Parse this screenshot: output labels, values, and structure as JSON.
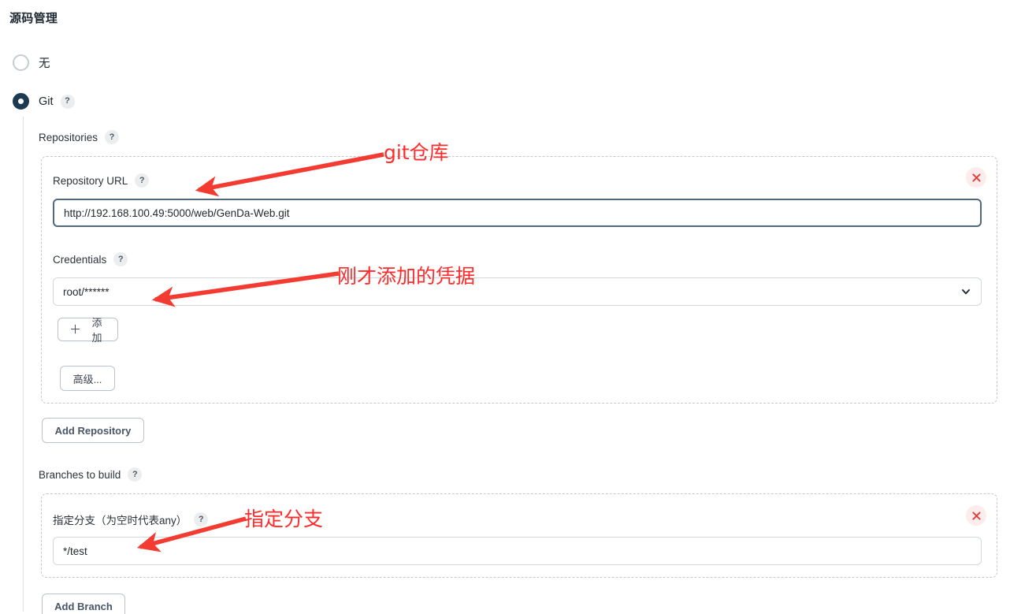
{
  "section": {
    "title": "源码管理"
  },
  "scm_options": [
    {
      "label": "无",
      "selected": false,
      "has_help": false
    },
    {
      "label": "Git",
      "selected": true,
      "has_help": true,
      "help_glyph": "?"
    }
  ],
  "git": {
    "repositories_label": "Repositories",
    "help_glyph": "?",
    "repository": {
      "url_label": "Repository URL",
      "url_value": "http://192.168.100.49:5000/web/GenDa-Web.git",
      "url_placeholder": "",
      "credentials_label": "Credentials",
      "credentials_value": "root/******",
      "add_credentials_label": "添加",
      "add_credentials_icon": "plus-icon",
      "advanced_label": "高级...",
      "delete_icon": "close-icon"
    },
    "add_repository_label": "Add Repository",
    "branches_label": "Branches to build",
    "branch": {
      "spec_label": "指定分支（为空时代表any）",
      "spec_value": "*/test",
      "delete_icon": "close-icon"
    },
    "add_branch_label": "Add Branch"
  },
  "annotations": [
    {
      "text": "git仓库",
      "target": "repository-url-field"
    },
    {
      "text": "刚才添加的凭据",
      "target": "credentials-select"
    },
    {
      "text": "指定分支",
      "target": "branch-spec-field"
    }
  ],
  "colors": {
    "annotation_red": "#ff2b2b",
    "radio_selected": "#1c3a52",
    "input_focus_border": "#51697c",
    "dashed_border": "#c2c8cf",
    "delete_bg": "#fdecec",
    "delete_fg": "#e53935"
  }
}
